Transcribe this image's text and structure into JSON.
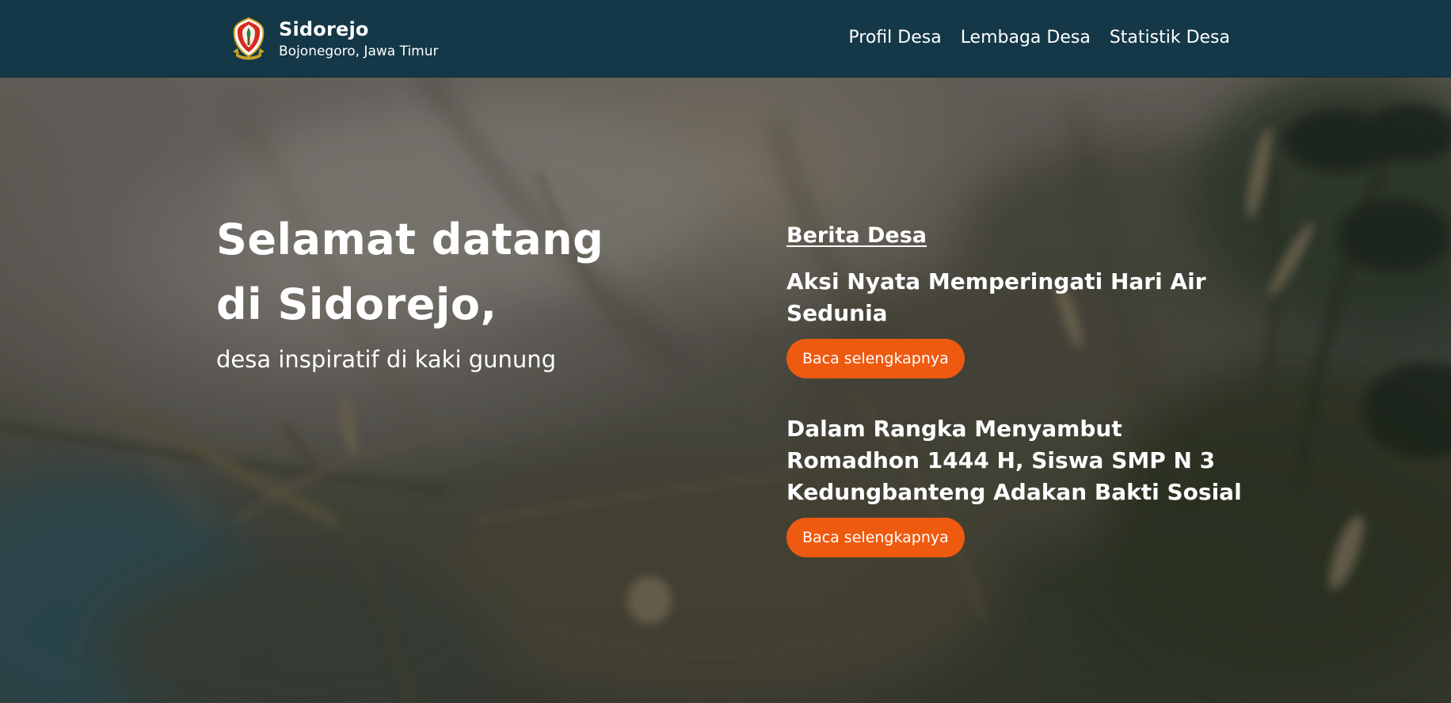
{
  "site": {
    "name": "Sidorejo",
    "location": "Bojonegoro, Jawa Timur",
    "logo_icon": "village-emblem-icon"
  },
  "nav": {
    "items": [
      {
        "label": "Profil Desa"
      },
      {
        "label": "Lembaga Desa"
      },
      {
        "label": "Statistik Desa"
      }
    ]
  },
  "hero": {
    "title_line1": "Selamat datang",
    "title_line2": "di Sidorejo,",
    "subtitle": "desa inspiratif di kaki gunung"
  },
  "news": {
    "heading": "Berita Desa",
    "items": [
      {
        "title": "Aksi Nyata Memperingati Hari Air Sedunia",
        "cta": "Baca selengkapnya"
      },
      {
        "title": "Dalam Rangka Menyambut Romadhon 1444 H, Siswa SMP N 3 Kedungbanteng Adakan Bakti Sosial",
        "cta": "Baca selengkapnya"
      }
    ]
  },
  "colors": {
    "header_bg": "#143847",
    "accent": "#ee5a10",
    "text": "#ffffff"
  }
}
